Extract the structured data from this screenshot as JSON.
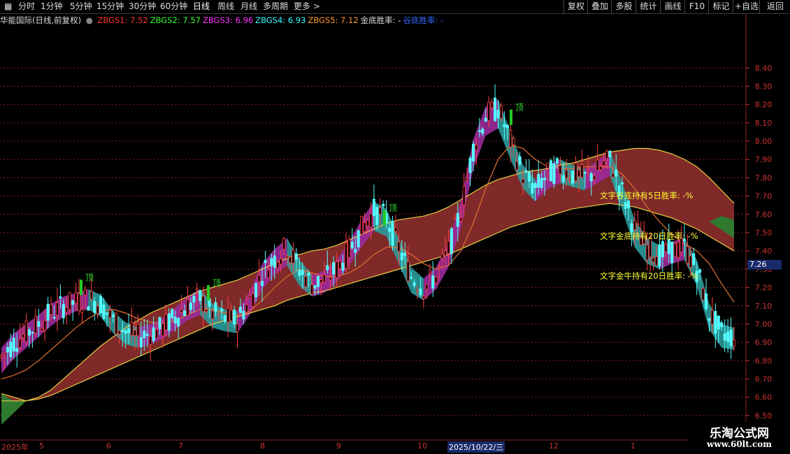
{
  "toolbar": {
    "left_items": [
      "分时",
      "1分钟",
      "5分钟",
      "15分钟",
      "30分钟",
      "60分钟",
      "日线",
      "周线",
      "月线",
      "多周期",
      "更多 >"
    ],
    "active": "日线",
    "right_items": [
      "复权",
      "叠加",
      "多股",
      "统计",
      "画线",
      "F10",
      "标记",
      "+自选",
      "返回"
    ]
  },
  "info": {
    "title": "华能国际(日线,前复权)",
    "indicators": [
      {
        "label": "ZBGS1: 7.52",
        "color": "#ff3333"
      },
      {
        "label": "ZBGS2: 7.57",
        "color": "#33ff33"
      },
      {
        "label": "ZBGS3: 6.96",
        "color": "#ff33ff"
      },
      {
        "label": "ZBGS4: 6.93",
        "color": "#33ffff"
      },
      {
        "label": "ZBGS5: 7.12",
        "color": "#ff9933"
      },
      {
        "label": "金底胜率: -",
        "color": "#dddddd"
      },
      {
        "label": "谷底胜率: -",
        "color": "#3366ff"
      }
    ]
  },
  "annotations": {
    "a1": "文字谷底持有5日胜率: -%",
    "a2": "文字金底持有20日胜率: -%",
    "a3": "文字金牛持有20日胜率: -%",
    "top_label": "顶"
  },
  "price_tag": "7.26",
  "xaxis": {
    "labels": [
      "2025年",
      "5",
      "6",
      "7",
      "8",
      "9",
      "10",
      "2025/10/22/三",
      "12",
      "1"
    ]
  },
  "watermark": {
    "line1": "乐淘公式网",
    "line2": "www.60lt.com"
  },
  "colors": {
    "up": "#ff4040",
    "down": "#55ffff",
    "ribbon": "#8b2c2c",
    "grid": "#7a1f1f"
  },
  "chart_data": {
    "type": "line",
    "title": "",
    "xlabel": "",
    "ylabel": "",
    "y_ticks": [
      8.4,
      8.3,
      8.2,
      8.1,
      8.0,
      7.9,
      7.8,
      7.7,
      7.6,
      7.5,
      7.4,
      7.3,
      7.2,
      7.1,
      7.0,
      6.9,
      6.8,
      6.7,
      6.6,
      6.5
    ],
    "ylim": [
      6.45,
      8.55
    ],
    "x_labels": [
      "2025年",
      "5",
      "6",
      "7",
      "8",
      "9",
      "10",
      "2025/10/22/三",
      "12",
      "1"
    ],
    "series": [
      {
        "name": "ZBGS1",
        "values": [
          6.82,
          6.9,
          6.95,
          7.0,
          7.06,
          7.1,
          7.12,
          7.14,
          7.11,
          7.02,
          6.96,
          6.93,
          6.95,
          6.98,
          7.04,
          7.1,
          7.14,
          7.06,
          7.03,
          7.02,
          7.13,
          7.28,
          7.36,
          7.42,
          7.3,
          7.22,
          7.24,
          7.3,
          7.4,
          7.52,
          7.62,
          7.58,
          7.42,
          7.26,
          7.2,
          7.26,
          7.4,
          7.62,
          7.96,
          8.14,
          8.18,
          8.0,
          7.82,
          7.74,
          7.82,
          7.85,
          7.82,
          7.8,
          7.84,
          7.9,
          7.72,
          7.52,
          7.42,
          7.38,
          7.4,
          7.42,
          7.3,
          7.06,
          6.95,
          6.93
        ]
      },
      {
        "name": "ZBGS2",
        "values": [
          6.78,
          6.86,
          6.92,
          6.98,
          7.04,
          7.09,
          7.12,
          7.13,
          7.09,
          7.0,
          6.94,
          6.92,
          6.94,
          6.97,
          7.02,
          7.07,
          7.1,
          7.03,
          7.01,
          7.0,
          7.1,
          7.24,
          7.32,
          7.37,
          7.26,
          7.2,
          7.22,
          7.28,
          7.37,
          7.47,
          7.56,
          7.53,
          7.38,
          7.22,
          7.18,
          7.24,
          7.36,
          7.57,
          7.9,
          8.08,
          8.12,
          7.95,
          7.79,
          7.72,
          7.79,
          7.82,
          7.8,
          7.78,
          7.82,
          7.86,
          7.67,
          7.47,
          7.38,
          7.35,
          7.38,
          7.4,
          7.26,
          7.02,
          6.92,
          6.91
        ]
      },
      {
        "name": "ZBGS3",
        "values": [
          6.58,
          6.58,
          6.58,
          6.59,
          6.61,
          6.64,
          6.67,
          6.7,
          6.73,
          6.76,
          6.79,
          6.82,
          6.85,
          6.88,
          6.91,
          6.94,
          6.97,
          7.0,
          7.02,
          7.04,
          7.06,
          7.08,
          7.1,
          7.13,
          7.15,
          7.17,
          7.18,
          7.2,
          7.22,
          7.24,
          7.26,
          7.28,
          7.3,
          7.32,
          7.34,
          7.36,
          7.38,
          7.41,
          7.44,
          7.47,
          7.5,
          7.53,
          7.55,
          7.57,
          7.59,
          7.61,
          7.63,
          7.64,
          7.65,
          7.66,
          7.65,
          7.64,
          7.62,
          7.6,
          7.58,
          7.55,
          7.52,
          7.48,
          7.44,
          7.4
        ]
      },
      {
        "name": "ZBGS4",
        "values": [
          6.62,
          6.6,
          6.58,
          6.6,
          6.64,
          6.7,
          6.76,
          6.82,
          6.88,
          6.93,
          6.98,
          7.02,
          7.06,
          7.09,
          7.12,
          7.15,
          7.18,
          7.2,
          7.22,
          7.24,
          7.27,
          7.3,
          7.33,
          7.36,
          7.38,
          7.4,
          7.41,
          7.43,
          7.46,
          7.49,
          7.52,
          7.55,
          7.57,
          7.58,
          7.59,
          7.61,
          7.64,
          7.68,
          7.72,
          7.76,
          7.79,
          7.81,
          7.83,
          7.84,
          7.85,
          7.87,
          7.88,
          7.9,
          7.92,
          7.94,
          7.95,
          7.96,
          7.96,
          7.95,
          7.93,
          7.9,
          7.86,
          7.8,
          7.73,
          7.66
        ]
      },
      {
        "name": "ZBGS5",
        "values": [
          6.7,
          6.72,
          6.75,
          6.8,
          6.86,
          6.92,
          6.98,
          7.03,
          7.07,
          7.08,
          7.06,
          7.03,
          7.01,
          7.0,
          7.02,
          7.05,
          7.08,
          7.08,
          7.06,
          7.05,
          7.07,
          7.13,
          7.2,
          7.26,
          7.3,
          7.28,
          7.26,
          7.26,
          7.28,
          7.32,
          7.38,
          7.42,
          7.42,
          7.38,
          7.33,
          7.3,
          7.32,
          7.4,
          7.55,
          7.74,
          7.9,
          7.98,
          7.96,
          7.9,
          7.86,
          7.85,
          7.85,
          7.86,
          7.86,
          7.86,
          7.82,
          7.74,
          7.64,
          7.56,
          7.49,
          7.44,
          7.4,
          7.33,
          7.22,
          7.12
        ]
      }
    ],
    "grid": true
  }
}
